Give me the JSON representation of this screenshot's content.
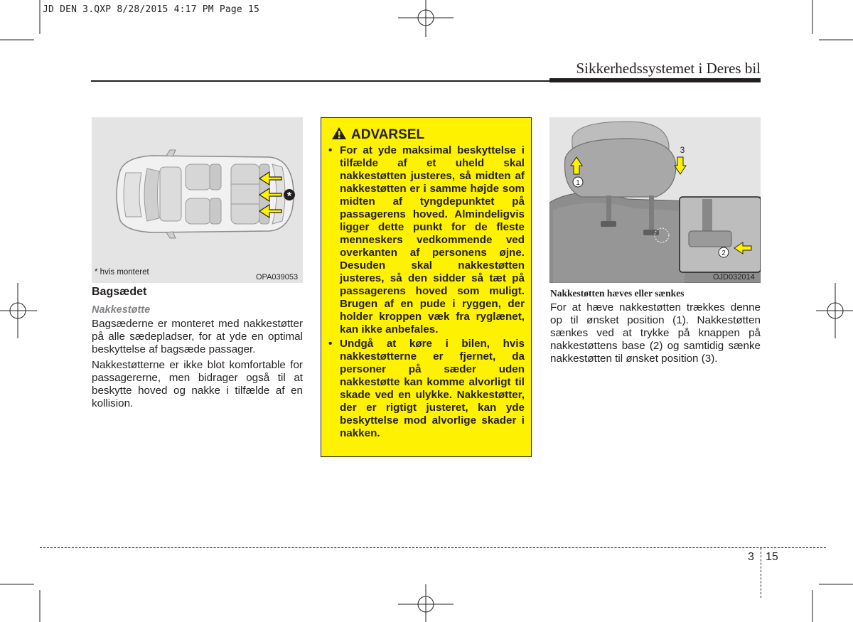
{
  "slug": "JD DEN 3.QXP  8/28/2015  4:17 PM  Page 15",
  "header": {
    "title": "Sikkerhedssystemet i Deres bil"
  },
  "left_figure": {
    "note": "* hvis monteret",
    "code": "OPA039053",
    "asterisk": "*"
  },
  "left": {
    "section_title": "Bagsædet",
    "subsection_title": "Nakkestøtte",
    "paragraphs": [
      "Bagsæderne er monteret med nakkestøtter på alle sædepladser, for at yde en optimal beskyttelse af bagsæde passager.",
      "Nakkestøtterne er ikke blot komfortable for passagererne, men bidrager også til at beskytte hoved og nakke i tilfælde af en kollision."
    ]
  },
  "warning": {
    "title": "ADVARSEL",
    "bullet": "•",
    "items": [
      "For at yde maksimal beskyttelse i tilfælde af et uheld skal nakkestøtten justeres, så midten af nakkestøtten er i samme højde som midten af tyngdepunktet på passagerens hoved. Almindeligvis ligger dette punkt for de fleste menneskers vedkommende ved overkanten af personens øjne. Desuden skal nakkestøtten justeres, så den sidder så tæt på passagerens hoved som muligt. Brugen af en pude i ryggen, der holder kroppen væk fra ryglænet, kan ikke anbefales.",
      "Undgå at køre i bilen, hvis nakkestøtterne er fjernet, da personer på sæder uden nakkestøtte kan komme alvorligt til skade ved en ulykke. Nakkestøtter, der er rigtigt justeret, kan yde beskyttelse mod alvorlige skader i nakken."
    ]
  },
  "right_figure": {
    "code": "OJD032014",
    "callout_1": "1",
    "callout_2": "2",
    "callout_3": "3"
  },
  "right": {
    "caption": "Nakkestøtten hæves eller sænkes",
    "paragraph": "For at hæve nakkestøtten trækkes denne op til ønsket position (1). Nakkestøtten sænkes ved at trykke på knappen på nakkestøttens base (2) og samtidig sænke nakkestøtten til ønsket position (3)."
  },
  "footer": {
    "chapter": "3",
    "page": "15"
  },
  "colors": {
    "warning_bg": "#fff200",
    "figure_bg": "#e4e4e4",
    "arrow_yellow": "#fff200",
    "text": "#231f20"
  }
}
